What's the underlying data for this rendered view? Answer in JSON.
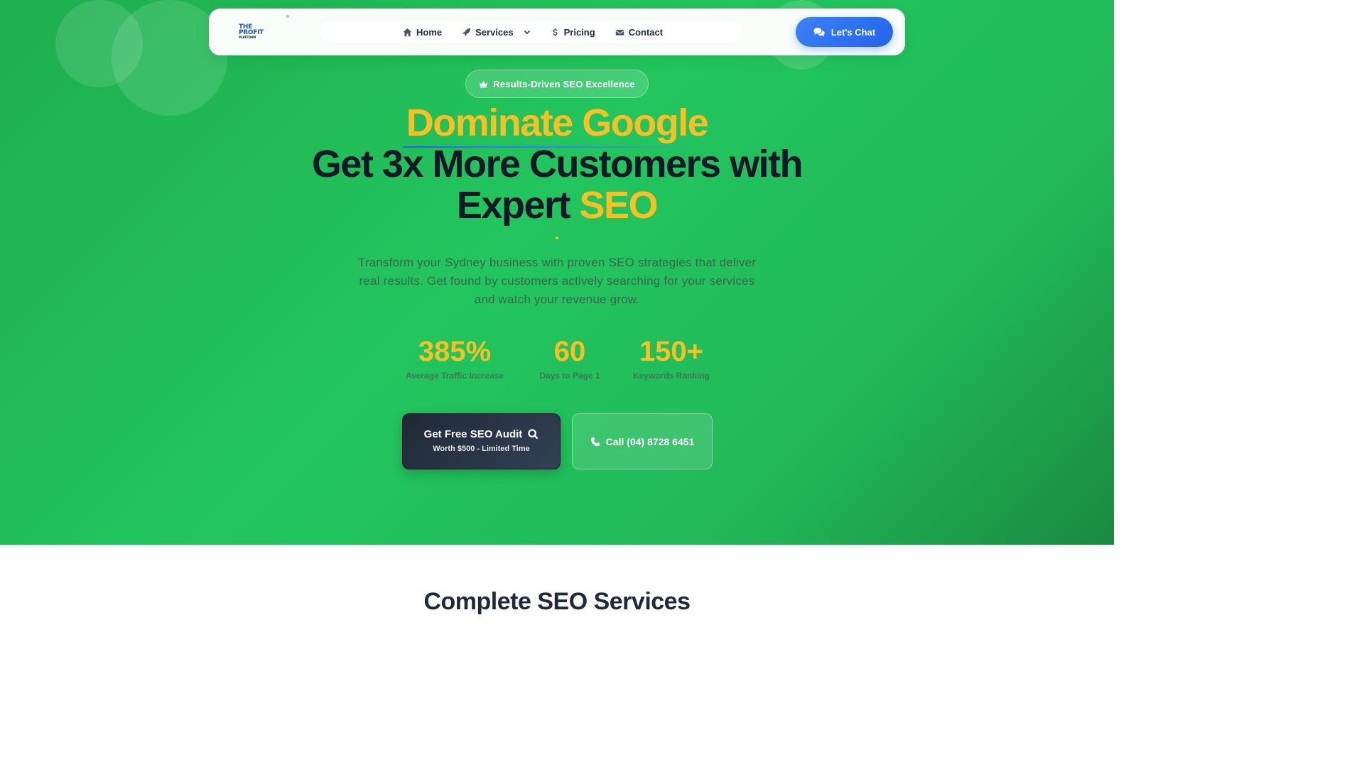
{
  "nav": {
    "logo": {
      "line1": "THE",
      "line2": "PROFIT",
      "line3": "PLATFORM"
    },
    "links": [
      {
        "label": "Home",
        "icon": "home-icon"
      },
      {
        "label": "Services",
        "icon": "rocket-icon"
      },
      {
        "label": "Pricing",
        "icon": "dollar-icon"
      },
      {
        "label": "Contact",
        "icon": "envelope-icon"
      }
    ],
    "chat_button": {
      "label": "Let's Chat",
      "icon": "chat-bubbles-icon"
    }
  },
  "hero": {
    "badge": {
      "label": "Results-Driven SEO Excellence",
      "icon": "crown-icon"
    },
    "heading_line1": "Dominate Google",
    "heading_line2": "Get 3x More Customers with",
    "heading_line3_prefix": "Expert",
    "heading_line3_accent": "SEO",
    "subtitle": "Transform your Sydney business with proven SEO strategies that deliver real results. Get found by customers actively searching for your services and watch your revenue grow.",
    "stats": [
      {
        "value": "385%",
        "label": "Average Traffic Increase"
      },
      {
        "value": "60",
        "label": "Days to Page 1"
      },
      {
        "value": "150+",
        "label": "Keywords Ranking"
      }
    ],
    "audit_button": {
      "label": "Get Free SEO Audit",
      "sublabel": "Worth $500 - Limited Time",
      "icon": "search-icon"
    },
    "call_button": {
      "label": "Call (04) 8728 6451",
      "icon": "phone-icon"
    }
  },
  "services": {
    "title": "Complete SEO Services"
  },
  "colors": {
    "hero_green": "#22c55e",
    "accent_yellow": "#fbbf24",
    "heading_dark": "#111827",
    "chat_blue": "#3b82f6"
  }
}
